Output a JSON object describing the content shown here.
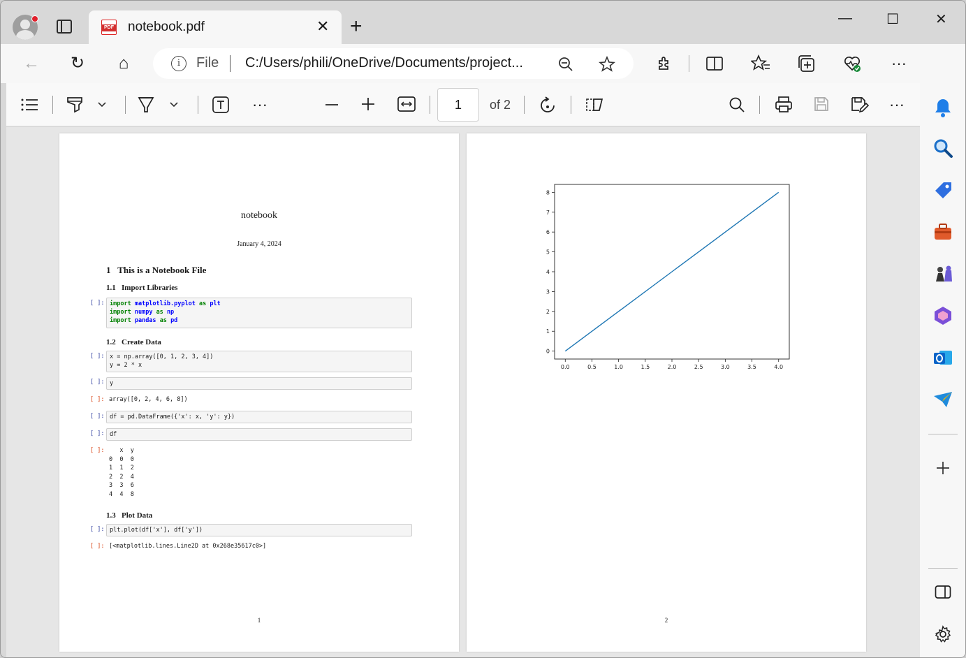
{
  "browser": {
    "tab_title": "notebook.pdf",
    "new_tab_label": "+",
    "tab_close_label": "✕",
    "window_controls": {
      "minimize": "—",
      "maximize": "☐",
      "close": "✕"
    },
    "address": {
      "scheme_label": "File",
      "url": "C:/Users/phili/OneDrive/Documents/project..."
    }
  },
  "pdf_toolbar": {
    "page_current": "1",
    "page_total_label": "of 2"
  },
  "pages": [
    {
      "title": "notebook",
      "date": "January 4, 2024",
      "section1": {
        "num": "1",
        "title": "This is a Notebook File"
      },
      "sub11": {
        "num": "1.1",
        "title": "Import Libraries"
      },
      "sub12": {
        "num": "1.2",
        "title": "Create Data"
      },
      "sub13": {
        "num": "1.3",
        "title": "Plot Data"
      },
      "prompt_in": "[ ]:",
      "prompt_out": "[ ]:",
      "code_import": [
        {
          "kw": "import",
          "mod": "matplotlib.pyplot",
          "as": "as",
          "alias": "plt"
        },
        {
          "kw": "import",
          "mod": "numpy",
          "as": "as",
          "alias": "np"
        },
        {
          "kw": "import",
          "mod": "pandas",
          "as": "as",
          "alias": "pd"
        }
      ],
      "code_x": "x = np.array([0, 1, 2, 3, 4])",
      "code_y": "y = 2 * x",
      "code_y_only": "y",
      "out_array": "array([0, 2, 4, 6, 8])",
      "code_df": "df = pd.DataFrame({'x': x, 'y': y})",
      "code_df_only": "df",
      "df_table": {
        "header": "   x  y",
        "rows": [
          "0  0  0",
          "1  1  2",
          "2  2  4",
          "3  3  6",
          "4  4  8"
        ]
      },
      "code_plot": "plt.plot(df['x'], df['y'])",
      "out_plot": "[<matplotlib.lines.Line2D at 0x268e35617c0>]",
      "page_number": "1"
    },
    {
      "page_number": "2"
    }
  ],
  "chart_data": {
    "type": "line",
    "x": [
      0.0,
      1.0,
      2.0,
      3.0,
      4.0
    ],
    "series": [
      {
        "values": [
          0,
          2,
          4,
          6,
          8
        ],
        "color": "#1f77b4"
      }
    ],
    "xlim": [
      -0.2,
      4.2
    ],
    "ylim": [
      -0.4,
      8.4
    ],
    "xticks": [
      "0.0",
      "0.5",
      "1.0",
      "1.5",
      "2.0",
      "2.5",
      "3.0",
      "3.5",
      "4.0"
    ],
    "yticks": [
      "0",
      "1",
      "2",
      "3",
      "4",
      "5",
      "6",
      "7",
      "8"
    ],
    "title": "",
    "xlabel": "",
    "ylabel": "",
    "grid": false
  }
}
